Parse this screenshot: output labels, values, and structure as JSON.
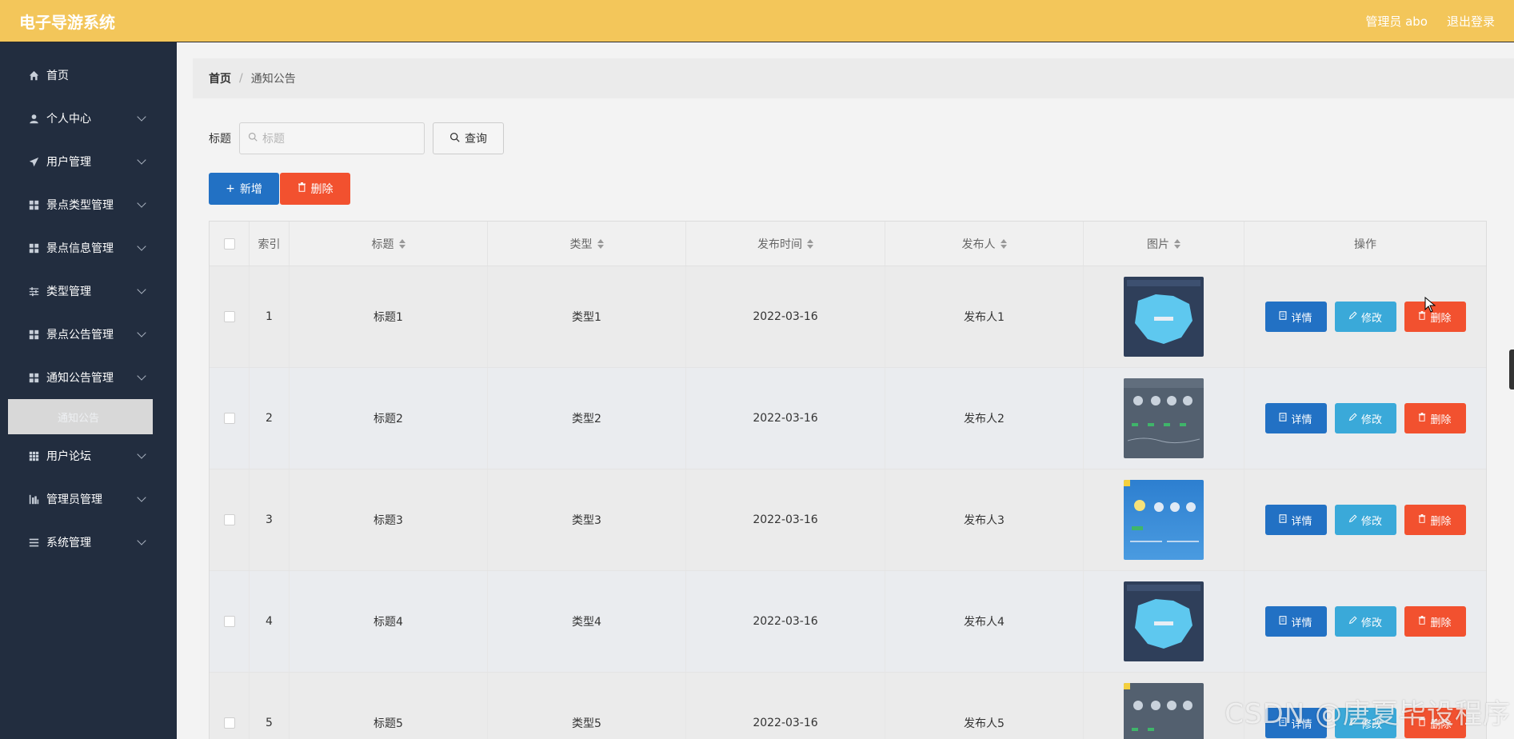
{
  "header": {
    "title": "电子导游系统",
    "user_label": "管理员 abo",
    "logout_label": "退出登录"
  },
  "sidebar": {
    "items": [
      {
        "label": "首页",
        "icon": "home-icon"
      },
      {
        "label": "个人中心",
        "icon": "user-icon"
      },
      {
        "label": "用户管理",
        "icon": "send-icon"
      },
      {
        "label": "景点类型管理",
        "icon": "grid-icon"
      },
      {
        "label": "景点信息管理",
        "icon": "grid-icon"
      },
      {
        "label": "类型管理",
        "icon": "sliders-icon"
      },
      {
        "label": "景点公告管理",
        "icon": "grid-icon"
      },
      {
        "label": "通知公告管理",
        "icon": "grid-icon"
      },
      {
        "label": "用户论坛",
        "icon": "apps-icon"
      },
      {
        "label": "管理员管理",
        "icon": "bar-chart-icon"
      },
      {
        "label": "系统管理",
        "icon": "menu-icon"
      }
    ],
    "active_sub": "通知公告"
  },
  "breadcrumb": {
    "home": "首页",
    "separator": "/",
    "current": "通知公告"
  },
  "search": {
    "label": "标题",
    "placeholder": "标题",
    "value": "",
    "query_label": "查询"
  },
  "actions": {
    "add_label": "新增",
    "delete_label": "删除"
  },
  "table": {
    "headers": {
      "index": "索引",
      "title": "标题",
      "type": "类型",
      "time": "发布时间",
      "publisher": "发布人",
      "image": "图片",
      "ops": "操作"
    },
    "op_labels": {
      "detail": "详情",
      "edit": "修改",
      "delete": "删除"
    },
    "rows": [
      {
        "index": "1",
        "title": "标题1",
        "type": "类型1",
        "time": "2022-03-16",
        "publisher": "发布人1"
      },
      {
        "index": "2",
        "title": "标题2",
        "type": "类型2",
        "time": "2022-03-16",
        "publisher": "发布人2"
      },
      {
        "index": "3",
        "title": "标题3",
        "type": "类型3",
        "time": "2022-03-16",
        "publisher": "发布人3"
      },
      {
        "index": "4",
        "title": "标题4",
        "type": "类型4",
        "time": "2022-03-16",
        "publisher": "发布人4"
      },
      {
        "index": "5",
        "title": "标题5",
        "type": "类型5",
        "time": "2022-03-16",
        "publisher": "发布人5"
      }
    ]
  },
  "watermark": "CSDN @唐夏毕设程序",
  "colors": {
    "header": "#f3c65a",
    "sidebar": "#222d3f",
    "primary": "#2271c4",
    "info": "#3aa9d9",
    "danger": "#f2512f"
  }
}
